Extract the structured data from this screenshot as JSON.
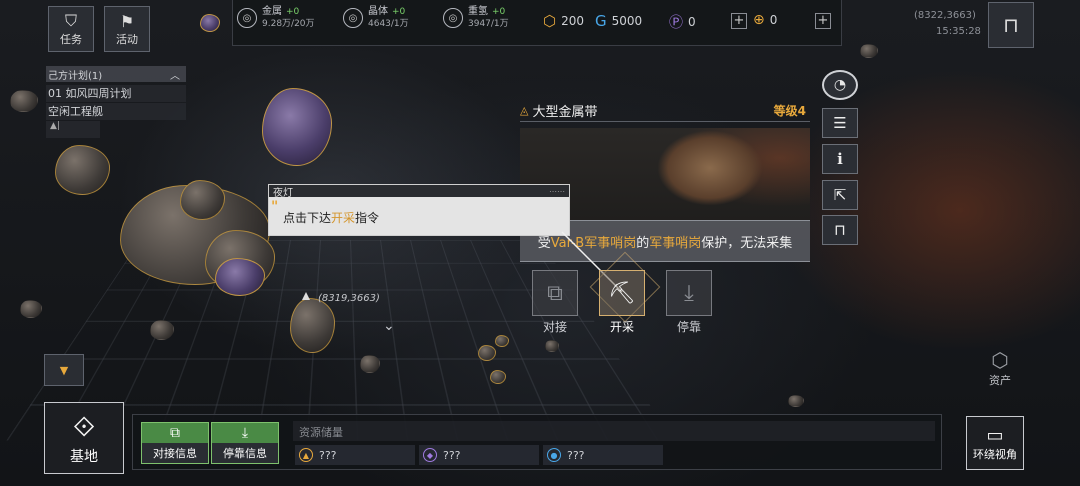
{
  "top_left": {
    "missions_label": "任务",
    "events_label": "活动"
  },
  "resources": [
    {
      "name": "金属",
      "plus": "+0",
      "value": "9.28万/20万",
      "icon": "◎"
    },
    {
      "name": "晶体",
      "plus": "+0",
      "value": "4643/1万",
      "icon": "◎"
    },
    {
      "name": "重氢",
      "plus": "+0",
      "value": "3947/1万",
      "icon": "◎"
    }
  ],
  "currencies": {
    "a_value": "200",
    "b_value": "5000",
    "c_value": "0",
    "d_value": "0"
  },
  "coords": {
    "top_coords": "(8322,3663)",
    "time": "15:35:28",
    "map_coords": "(8319,3663)"
  },
  "plans": {
    "title": "己方计划(1)",
    "items": [
      "01 如风四周计划",
      "空闲工程舰"
    ]
  },
  "target": {
    "name": "大型金属带",
    "level": "等级4",
    "protect_prefix": "受",
    "protect_name": "Var-B军事哨岗",
    "protect_mid": "的",
    "protect_type": "军事哨岗",
    "protect_suffix": "保护，无法采集"
  },
  "tutorial": {
    "speaker": "夜灯",
    "text_pre": "点击下达",
    "text_hl": "开采",
    "text_post": "指令"
  },
  "actions": {
    "dock": "对接",
    "mine": "开采",
    "park": "停靠"
  },
  "bottom": {
    "base_label": "基地",
    "dock_info": "对接信息",
    "park_info": "停靠信息",
    "storage_title": "资源储量",
    "slot1": "???",
    "slot2": "???",
    "slot3": "???",
    "assets_label": "资产",
    "orbit_view": "环绕视角"
  },
  "colors": {
    "accent_gold": "#e8a93c",
    "green": "#4a8a45",
    "purple": "#a07be0",
    "blue": "#49a7e8"
  }
}
